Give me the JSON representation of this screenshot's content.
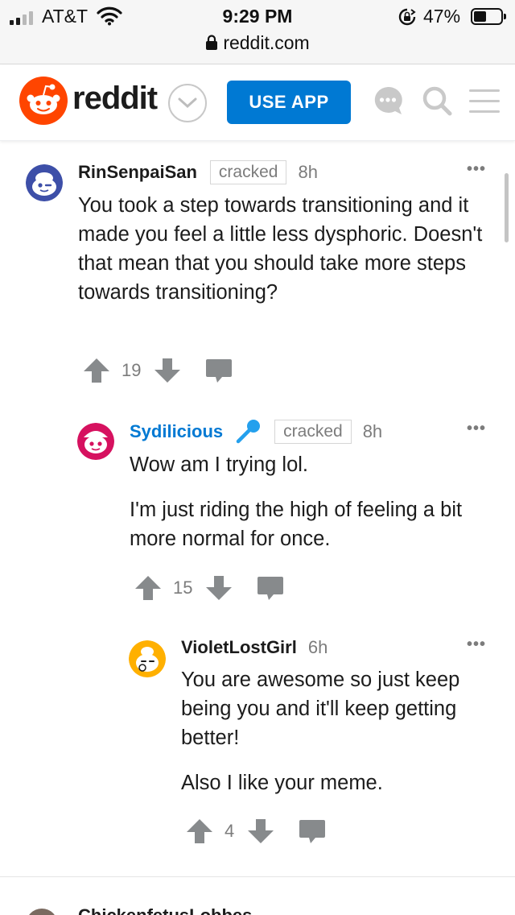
{
  "status_bar": {
    "carrier": "AT&T",
    "time": "9:29 PM",
    "battery_percent_label": "47%",
    "battery_level": 0.47,
    "url": "reddit.com"
  },
  "header": {
    "wordmark": "reddit",
    "use_app_label": "USE APP",
    "accent_color": "#0079d3",
    "logo_color": "#ff4500"
  },
  "comments": [
    {
      "username": "RinSenpaiSan",
      "flair": "cracked",
      "age": "8h",
      "more": "•••",
      "paragraphs": [
        "You took a step towards transitioning and it made you feel a little less dysphoric. Doesn't that mean that you should take more steps towards transitioning?"
      ],
      "votes": "19",
      "avatar_color": "#3d4fa8"
    },
    {
      "username": "Sydilicious",
      "flair": "cracked",
      "age": "8h",
      "more": "•••",
      "paragraphs": [
        "Wow am I trying lol.",
        "I'm just riding the high of feeling a bit more normal for once."
      ],
      "votes": "15",
      "avatar_color": "#d6115f"
    },
    {
      "username": "VioletLostGirl",
      "flair": "",
      "age": "6h",
      "more": "•••",
      "paragraphs": [
        "You are awesome so just keep being you and it'll keep getting better!",
        "Also I like your meme."
      ],
      "votes": "4",
      "avatar_color": "#ffb000"
    }
  ],
  "next_comment": {
    "username": "ChickenfetusLobbes"
  }
}
